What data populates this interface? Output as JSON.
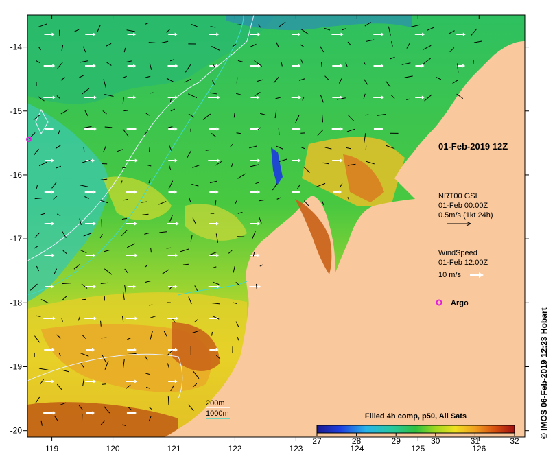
{
  "map": {
    "lon_ticks": [
      "119",
      "120",
      "121",
      "122",
      "123",
      "124",
      "125",
      "126"
    ],
    "lat_ticks": [
      "-14",
      "-15",
      "-16",
      "-17",
      "-18",
      "-19",
      "-20"
    ],
    "lon_range": [
      118.6,
      126.75
    ],
    "lat_range": [
      -20.1,
      -13.5
    ]
  },
  "annotations": {
    "datetime": "01-Feb-2019 12Z",
    "current_source": "NRT00 GSL",
    "current_time": "01-Feb 00:00Z",
    "current_scale": "0.5m/s (1kt 24h)",
    "wind_title": "WindSpeed",
    "wind_time": "01-Feb 12:00Z",
    "wind_scale": "10 m/s",
    "argo_label": "Argo",
    "depth_200": "200m",
    "depth_1000": "1000m",
    "credit": "© IMOS 06-Feb-2019 12:23 Hobart"
  },
  "colorbar": {
    "title": "Filled 4h comp, p50, All Sats",
    "ticks": [
      "27",
      "28",
      "29",
      "30",
      "31",
      "32"
    ],
    "range": [
      27,
      32
    ]
  },
  "colors": {
    "land": "#f9c89c",
    "sst_cold": "#1b4fd0",
    "sst_mid": "#34c050",
    "sst_warm": "#f0dc20",
    "sst_hot": "#c04010",
    "argo": "#e01ee0",
    "contour_200m": "#e8f0ff",
    "contour_1000m": "#40d8c8"
  }
}
